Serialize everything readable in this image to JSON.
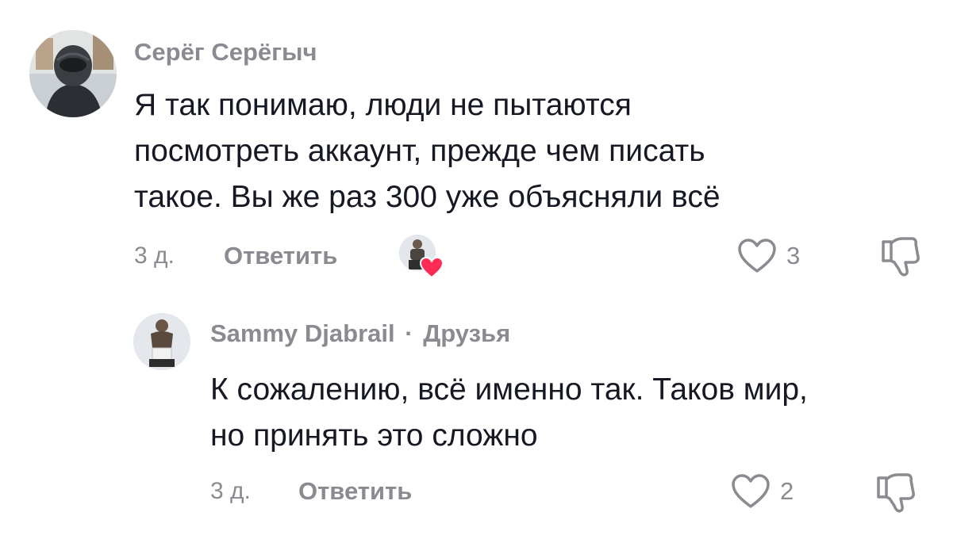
{
  "comments": [
    {
      "username": "Серёг Серёгыч",
      "lines": [
        "Я так понимаю, люди не пытаются",
        "посмотреть аккаунт, прежде чем писать",
        "такое. Вы же раз 300 уже объясняли всё"
      ],
      "time": "3 д.",
      "reply_label": "Ответить",
      "likes": "3",
      "liked_by_creator": true
    },
    {
      "username": "Sammy Djabrail",
      "separator": "·",
      "relation": "Друзья",
      "lines": [
        "К сожалению, всё именно так. Таков мир,",
        "но принять это сложно"
      ],
      "time": "3 д.",
      "reply_label": "Ответить",
      "likes": "2"
    }
  ],
  "icons": {
    "like": "heart-outline-icon",
    "dislike": "thumbs-down-outline-icon",
    "creator_like": "creator-heart-icon"
  },
  "colors": {
    "text": "#161823",
    "muted": "#8a8b91",
    "heart": "#fe2c55"
  }
}
